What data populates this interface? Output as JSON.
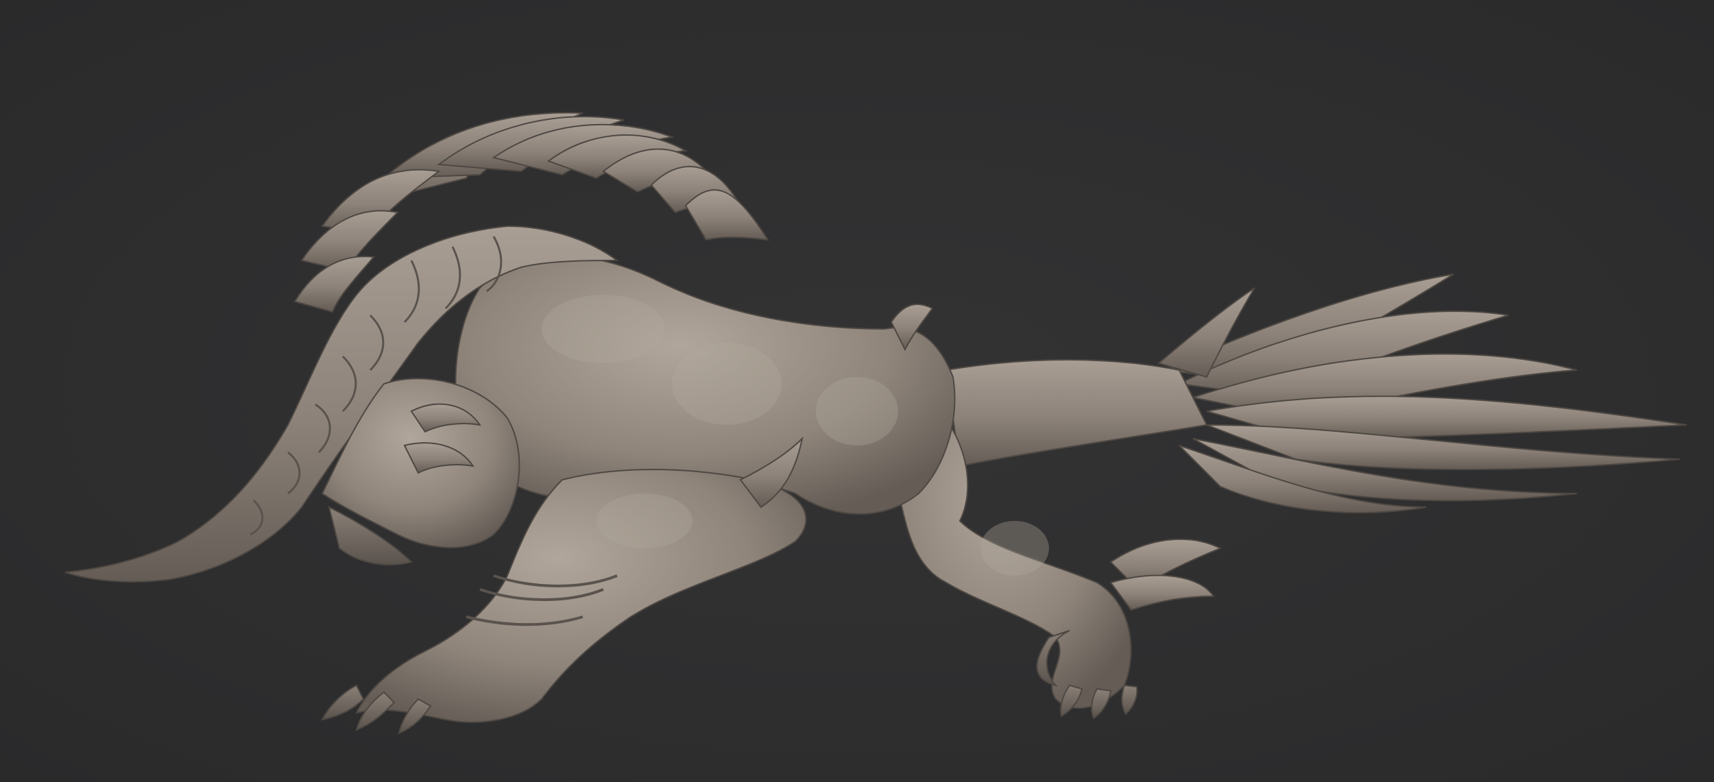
{
  "scene": {
    "background_color": "#2e2e2f",
    "clay_color": "#8c8279",
    "clay_highlight": "#a69c92",
    "clay_shadow": "#5e5650",
    "subject_icon": "creature-sculpt-icon"
  }
}
